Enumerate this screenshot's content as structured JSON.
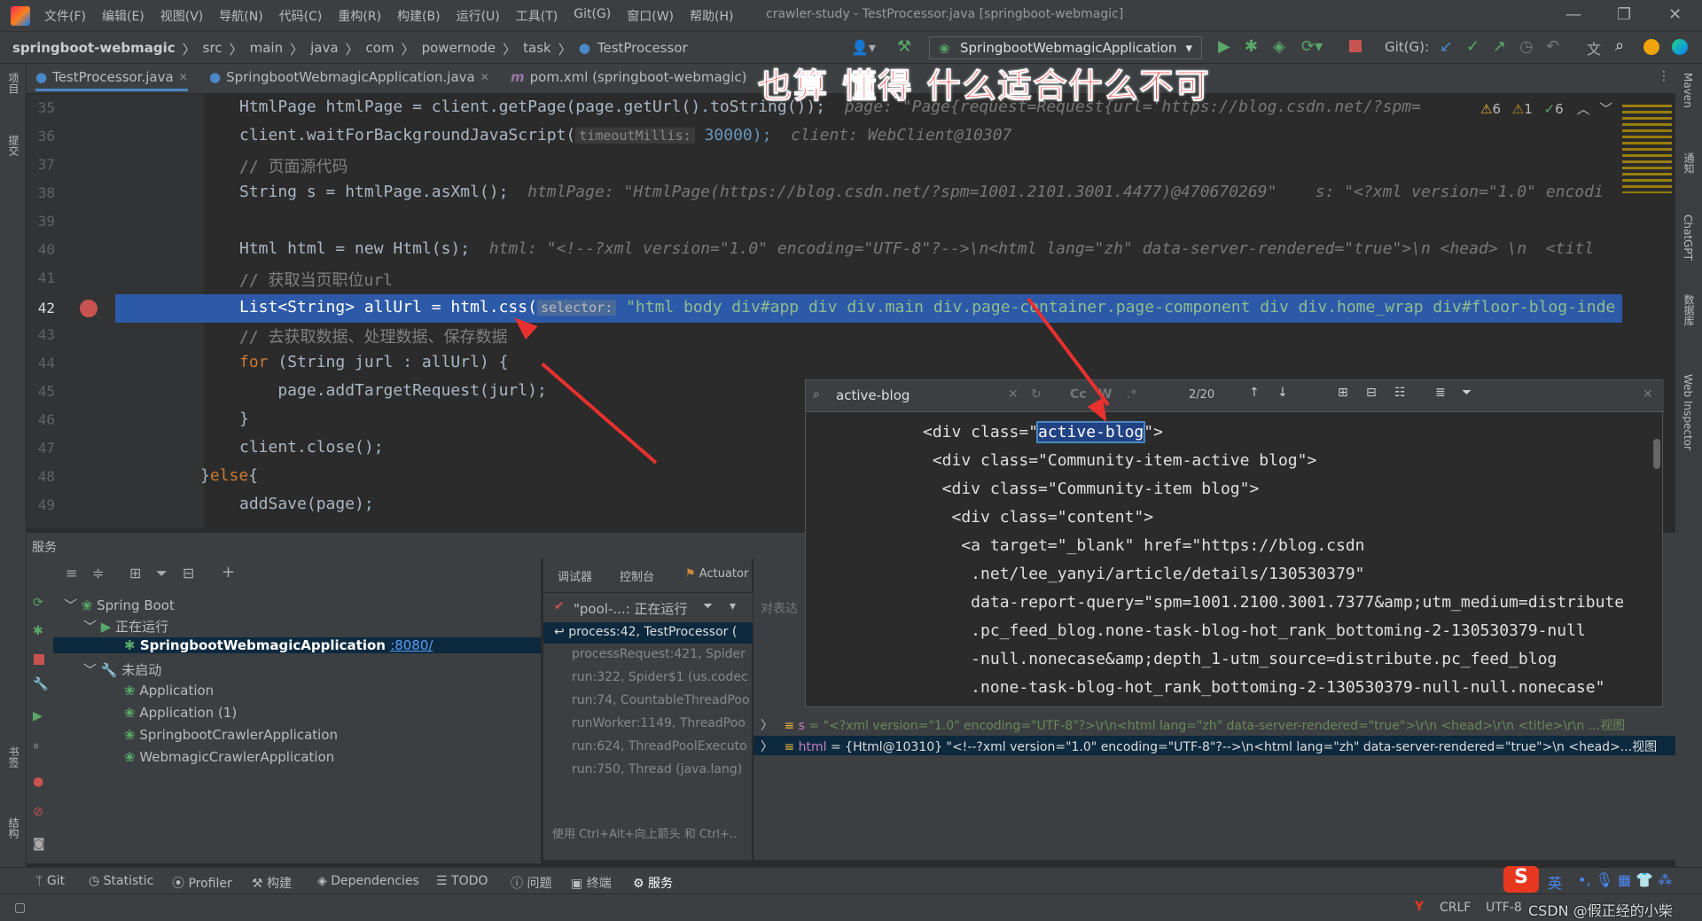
{
  "window": {
    "title": "crawler-study - TestProcessor.java [springboot-webmagic]",
    "menu": [
      "文件(F)",
      "编辑(E)",
      "视图(V)",
      "导航(N)",
      "代码(C)",
      "重构(R)",
      "构建(B)",
      "运行(U)",
      "工具(T)",
      "Git(G)",
      "窗口(W)",
      "帮助(H)"
    ]
  },
  "breadcrumb": [
    "springboot-webmagic",
    "src",
    "main",
    "java",
    "com",
    "powernode",
    "task",
    "TestProcessor"
  ],
  "run_config": "SpringbootWebmagicApplication",
  "git_label": "Git(G):",
  "tabs": [
    {
      "label": "TestProcessor.java"
    },
    {
      "label": "SpringbootWebmagicApplication.java"
    },
    {
      "label": "pom.xml (springboot-webmagic)"
    }
  ],
  "overlay_text": "也算 懂得  什么适合什么不可",
  "inspections": {
    "warnings": "6",
    "weak": "1",
    "ok": "6"
  },
  "editor": {
    "lines": [
      {
        "n": "35",
        "code": "HtmlPage htmlPage = client.getPage(page.getUrl().toString());",
        "hint": "page: \"Page{request=Request{url='https://blog.csdn.net/?spm="
      },
      {
        "n": "36",
        "code": "client.waitForBackgroundJavaScript(",
        "param": "timeoutMillis:",
        "code2": " 30000);",
        "hint": "client: WebClient@10307"
      },
      {
        "n": "37",
        "comment": "// 页面源代码"
      },
      {
        "n": "38",
        "code": "String s = htmlPage.asXml();",
        "hint": "htmlPage: \"HtmlPage(https://blog.csdn.net/?spm=1001.2101.3001.4477)@470670269\"    s: \"<?xml version=\"1.0\" encodi"
      },
      {
        "n": "39",
        "code": ""
      },
      {
        "n": "40",
        "code": "Html html = new Html(s);",
        "hint": "html: \"<!--?xml version=\"1.0\" encoding=\"UTF-8\"?-->\\n<html lang=\"zh\" data-server-rendered=\"true\">\\n <head> \\n  <titl"
      },
      {
        "n": "41",
        "comment": "// 获取当页职位url"
      },
      {
        "n": "42",
        "code": "List<String> allUrl = html.css(",
        "param": "selector:",
        "code2": " \"html body div#app div div.main div.page-container.page-component div div.home_wrap div#floor-blog-inde"
      },
      {
        "n": "43",
        "comment": "// 去获取数据、处理数据、保存数据"
      },
      {
        "n": "44",
        "code": "for (String jurl : allUrl) {"
      },
      {
        "n": "45",
        "code": "    page.addTargetRequest(jurl);"
      },
      {
        "n": "46",
        "code": "}"
      },
      {
        "n": "47",
        "code": "client.close();"
      },
      {
        "n": "48",
        "code": "}else{"
      },
      {
        "n": "49",
        "code": "addSave(page);"
      }
    ]
  },
  "find_popup": {
    "query": "active-blog",
    "count": "2/20",
    "lines": [
      {
        "pre": "<div class=\"",
        "match": "active-blog",
        "post": "\">"
      },
      {
        "pre": " <div class=\"Community-item-active blog\">"
      },
      {
        "pre": "  <div class=\"Community-item blog\">"
      },
      {
        "pre": "   <div class=\"content\">"
      },
      {
        "pre": "    <a target=\"_blank\" href=\"https://blog.csdn"
      },
      {
        "pre": "     .net/lee_yanyi/article/details/130530379\""
      },
      {
        "pre": "     data-report-query=\"spm=1001.2100.3001.7377&amp;utm_medium=distribute"
      },
      {
        "pre": "     .pc_feed_blog.none-task-blog-hot_rank_bottoming-2-130530379-null"
      },
      {
        "pre": "     -null.nonecase&amp;depth_1-utm_source=distribute.pc_feed_blog"
      },
      {
        "pre": "     .none-task-blog-hot_rank_bottoming-2-130530379-null-null.nonecase\""
      }
    ]
  },
  "services": {
    "header": "服务",
    "tree": [
      {
        "label": "Spring Boot",
        "level": 0
      },
      {
        "label": "正在运行",
        "level": 1
      },
      {
        "label": "SpringbootWebmagicApplication",
        "port": ":8080/",
        "level": 2,
        "selected": true
      },
      {
        "label": "未启动",
        "level": 1
      },
      {
        "label": "Application",
        "level": 2
      },
      {
        "label": "Application (1)",
        "level": 2
      },
      {
        "label": "SpringbootCrawlerApplication",
        "level": 2
      },
      {
        "label": "WebmagicCrawlerApplication",
        "level": 2
      }
    ]
  },
  "debugger": {
    "tabs": [
      "调试器",
      "控制台",
      "Actuator"
    ],
    "thread": "\"pool-...: 正在运行",
    "frames": [
      "process:42, TestProcessor (",
      "processRequest:421, Spider",
      "run:322, Spider$1 (us.codec",
      "run:74, CountableThreadPoo",
      "runWorker:1149, ThreadPoo",
      "run:624, ThreadPoolExecuto",
      "run:750, Thread (java.lang)"
    ],
    "hint": "使用 Ctrl+Alt+向上箭头 和 Ctrl+..",
    "eval_placeholder": "对表达",
    "vars": [
      {
        "name": "s",
        "value": "= \"<?xml version=\"1.0\" encoding=\"UTF-8\"?>\\r\\n<html lang=\"zh\" data-server-rendered=\"true\">\\r\\n  <head>\\r\\n    <title>\\r\\n ...视图"
      },
      {
        "name": "html",
        "value": "= {Html@10310} \"<!--?xml version=\"1.0\" encoding=\"UTF-8\"?-->\\n<html lang=\"zh\" data-server-rendered=\"true\">\\n <head>...视图"
      }
    ]
  },
  "bottom_tools": [
    "Git",
    "Statistic",
    "Profiler",
    "构建",
    "Dependencies",
    "TODO",
    "问题",
    "终端",
    "服务"
  ],
  "status": {
    "encoding": "CRLF",
    "charset": "UTF-8",
    "watermark": "CSDN @假正经的小柴",
    "ime": "英"
  },
  "right_tools": [
    "Maven",
    "通知",
    "ChatGPT",
    "数据库",
    "Web Inspector"
  ],
  "left_tools": [
    "项目",
    "提交",
    "书签",
    "结构"
  ]
}
